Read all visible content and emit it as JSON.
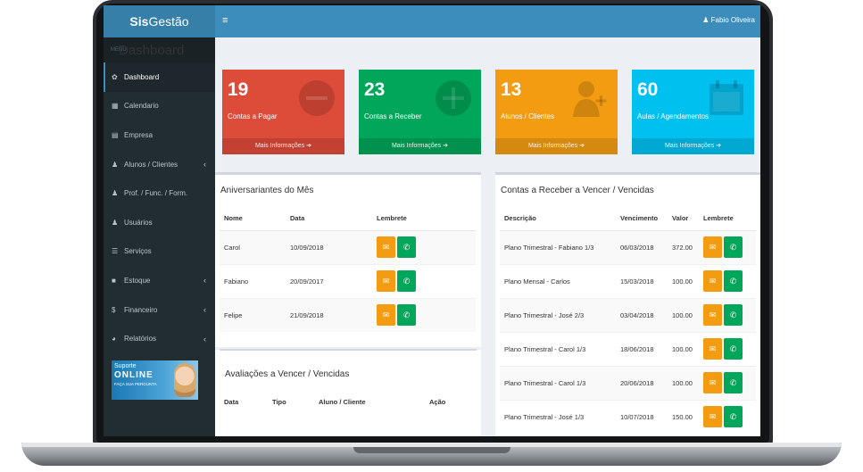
{
  "app": {
    "logo_bold": "Sis",
    "logo_rest": "Gestão",
    "user_name": "Fabio Oliveira"
  },
  "sidebar": {
    "menu_header": "MENU",
    "items": [
      {
        "label": "Dashboard",
        "icon": "dashboard-icon",
        "glyph": "✿",
        "has_children": false,
        "active": true
      },
      {
        "label": "Calendario",
        "icon": "calendar-icon",
        "glyph": "▦",
        "has_children": false
      },
      {
        "label": "Empresa",
        "icon": "building-icon",
        "glyph": "▤",
        "has_children": false
      },
      {
        "label": "Alunos / Clientes",
        "icon": "user-icon",
        "glyph": "♟",
        "has_children": true
      },
      {
        "label": "Prof. / Func. / Form.",
        "icon": "user-icon",
        "glyph": "♟",
        "has_children": false
      },
      {
        "label": "Usuários",
        "icon": "users-icon",
        "glyph": "♟",
        "has_children": false
      },
      {
        "label": "Serviços",
        "icon": "sliders-icon",
        "glyph": "☰",
        "has_children": false
      },
      {
        "label": "Estoque",
        "icon": "box-icon",
        "glyph": "■",
        "has_children": true
      },
      {
        "label": "Financeiro",
        "icon": "dollar-icon",
        "glyph": "$",
        "has_children": true
      },
      {
        "label": "Relatórios",
        "icon": "pie-chart-icon",
        "glyph": "◕",
        "has_children": true
      }
    ],
    "support": {
      "line1": "Suporte",
      "line2": "ONLINE",
      "line3": "FAÇA SUA PERGUNTA"
    }
  },
  "page": {
    "title": "Dashboard"
  },
  "info_boxes": [
    {
      "value": "19",
      "label": "Contas a Pagar",
      "more": "Mais Informações",
      "color": "#dd4b39",
      "icon": "minus-circle-icon"
    },
    {
      "value": "23",
      "label": "Contas a Receber",
      "more": "Mais Informações",
      "color": "#00a65a",
      "icon": "plus-circle-icon"
    },
    {
      "value": "13",
      "label": "Alunos / Clientes",
      "more": "Mais Informações",
      "color": "#f39c12",
      "icon": "user-plus-icon"
    },
    {
      "value": "60",
      "label": "Aulas / Agendamentos",
      "more": "Mais Informações",
      "color": "#00c0ef",
      "icon": "calendar-icon"
    }
  ],
  "birthdays": {
    "title": "Aniversariantes do Mês",
    "columns": [
      "Nome",
      "Data",
      "Lembrete"
    ],
    "rows": [
      {
        "name": "Carol",
        "date": "10/09/2018"
      },
      {
        "name": "Fabiano",
        "date": "20/09/2017"
      },
      {
        "name": "Felipe",
        "date": "21/09/2018"
      }
    ]
  },
  "evaluations": {
    "title": "Avaliações a Vencer / Vencidas",
    "columns": [
      "Data",
      "Tipo",
      "Aluno / Cliente",
      "Ação"
    ]
  },
  "receivables": {
    "title": "Contas a Receber a Vencer / Vencidas",
    "columns": [
      "Descrição",
      "Vencimento",
      "Valor",
      "Lembrete"
    ],
    "rows": [
      {
        "desc": "Plano Trimestral - Fabiano 1/3",
        "due": "06/03/2018",
        "value": "372.00"
      },
      {
        "desc": "Plano Mensal - Carlos",
        "due": "15/03/2018",
        "value": "100.00"
      },
      {
        "desc": "Plano Trimestral - José 2/3",
        "due": "03/04/2018",
        "value": "100.00"
      },
      {
        "desc": "Plano Trimestral - Carol 1/3",
        "due": "18/06/2018",
        "value": "100.00"
      },
      {
        "desc": "Plano Trimestral - Carol 1/3",
        "due": "20/06/2018",
        "value": "100.00"
      },
      {
        "desc": "Plano Trimestral - José 1/3",
        "due": "10/07/2018",
        "value": "150.00"
      }
    ]
  }
}
